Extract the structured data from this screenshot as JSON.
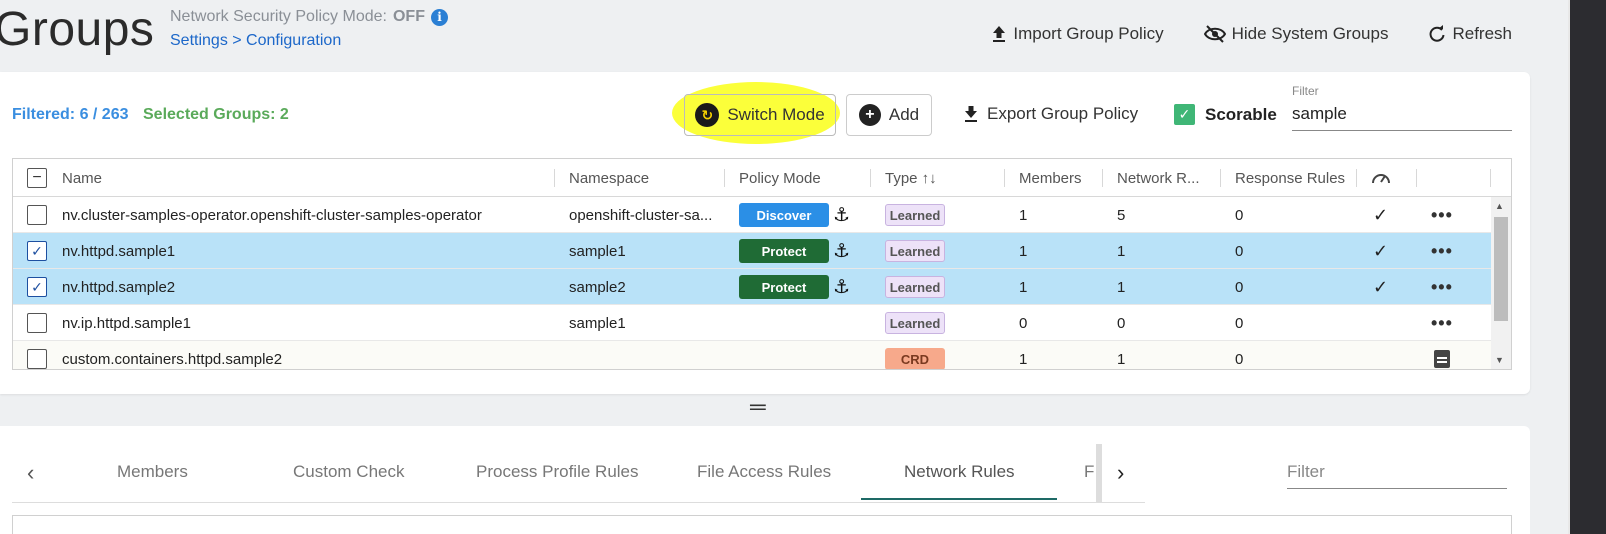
{
  "header": {
    "title": "Groups",
    "mode_label": "Network Security Policy Mode:",
    "mode_value": "OFF",
    "breadcrumb": "Settings > Configuration",
    "actions": {
      "import": "Import Group Policy",
      "hide": "Hide System Groups",
      "refresh": "Refresh"
    }
  },
  "toolbar": {
    "filtered": "Filtered: 6 / 263",
    "selected": "Selected Groups:  2",
    "switch_mode": "Switch Mode",
    "add": "Add",
    "export": "Export Group Policy",
    "scorable": "Scorable",
    "filter_label": "Filter",
    "filter_value": "sample"
  },
  "grid": {
    "columns": [
      "Name",
      "Namespace",
      "Policy Mode",
      "Type ↑↓",
      "Members",
      "Network R...",
      "Response Rules"
    ],
    "rows": [
      {
        "name": "nv.cluster-samples-operator.openshift-cluster-samples-operator",
        "namespace": "openshift-cluster-sa...",
        "mode": "Discover",
        "type": "Learned",
        "members": "1",
        "network": "5",
        "response": "0",
        "scored": "✓",
        "selected": false
      },
      {
        "name": "nv.httpd.sample1",
        "namespace": "sample1",
        "mode": "Protect",
        "type": "Learned",
        "members": "1",
        "network": "1",
        "response": "0",
        "scored": "✓",
        "selected": true
      },
      {
        "name": "nv.httpd.sample2",
        "namespace": "sample2",
        "mode": "Protect",
        "type": "Learned",
        "members": "1",
        "network": "1",
        "response": "0",
        "scored": "✓",
        "selected": true
      },
      {
        "name": "nv.ip.httpd.sample1",
        "namespace": "sample1",
        "mode": "",
        "type": "Learned",
        "members": "0",
        "network": "0",
        "response": "0",
        "scored": "",
        "selected": false
      },
      {
        "name": "custom.containers.httpd.sample2",
        "namespace": "",
        "mode": "",
        "type": "CRD",
        "members": "1",
        "network": "1",
        "response": "0",
        "scored": "",
        "selected": false
      }
    ]
  },
  "tabs": {
    "items": [
      "Members",
      "Custom Check",
      "Process Profile Rules",
      "File Access Rules",
      "Network Rules",
      "F"
    ],
    "active": "Network Rules",
    "filter_placeholder": "Filter"
  },
  "icons": {
    "upload": "upload-icon",
    "eye_off": "eye-off-icon",
    "refresh": "refresh-icon",
    "info": "info-icon",
    "sync": "sync-icon",
    "plus": "plus-circle-icon",
    "download": "download-icon",
    "anchor": "anchor-icon",
    "gauge": "gauge-icon",
    "more": "more-horizontal-icon",
    "document": "document-icon"
  },
  "colors": {
    "discover": "#2b8fe6",
    "protect": "#1f6b35",
    "learned_bg": "#ede2f8",
    "crd_bg": "#f7a98b",
    "selected_row": "#b9e2f8",
    "highlight": "#fbff3a",
    "link": "#1c67c9",
    "filtered_text": "#3a8ee0",
    "selected_text": "#5aaa5a"
  }
}
